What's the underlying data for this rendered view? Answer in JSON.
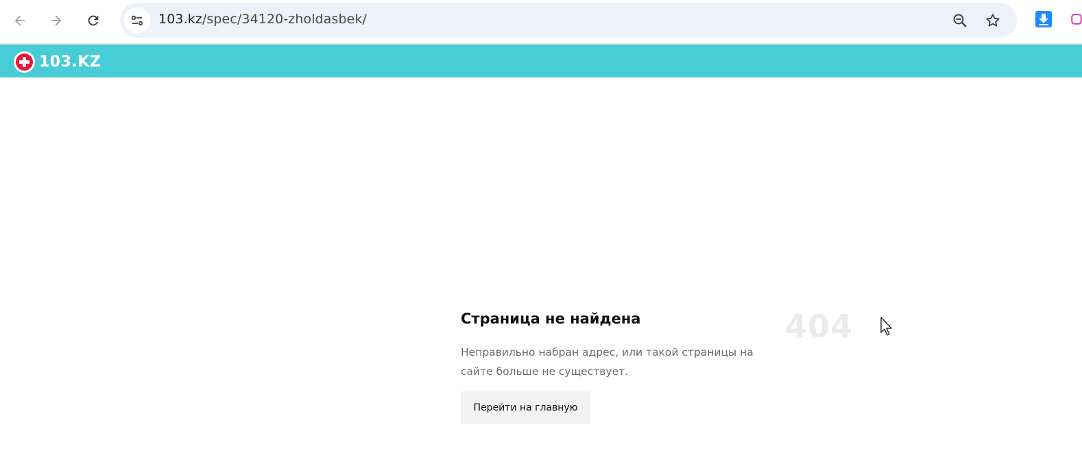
{
  "browser": {
    "url_host": "103.kz",
    "url_path": "/spec/34120-zholdasbek/",
    "back_icon": "arrow-left-icon",
    "forward_icon": "arrow-right-icon",
    "reload_icon": "reload-icon",
    "site_info_icon": "tune-icon",
    "zoom_icon": "zoom-out-icon",
    "bookmark_icon": "star-icon",
    "download_icon": "download-icon"
  },
  "site": {
    "logo_text": "103.KZ",
    "brand_color": "#48ccd6",
    "logo_mark_color": "#e8173c"
  },
  "error": {
    "title": "Страница не найдена",
    "description": "Неправильно набран адрес, или такой страницы на сайте больше не существует.",
    "code": "404",
    "home_button_label": "Перейти на главную"
  }
}
